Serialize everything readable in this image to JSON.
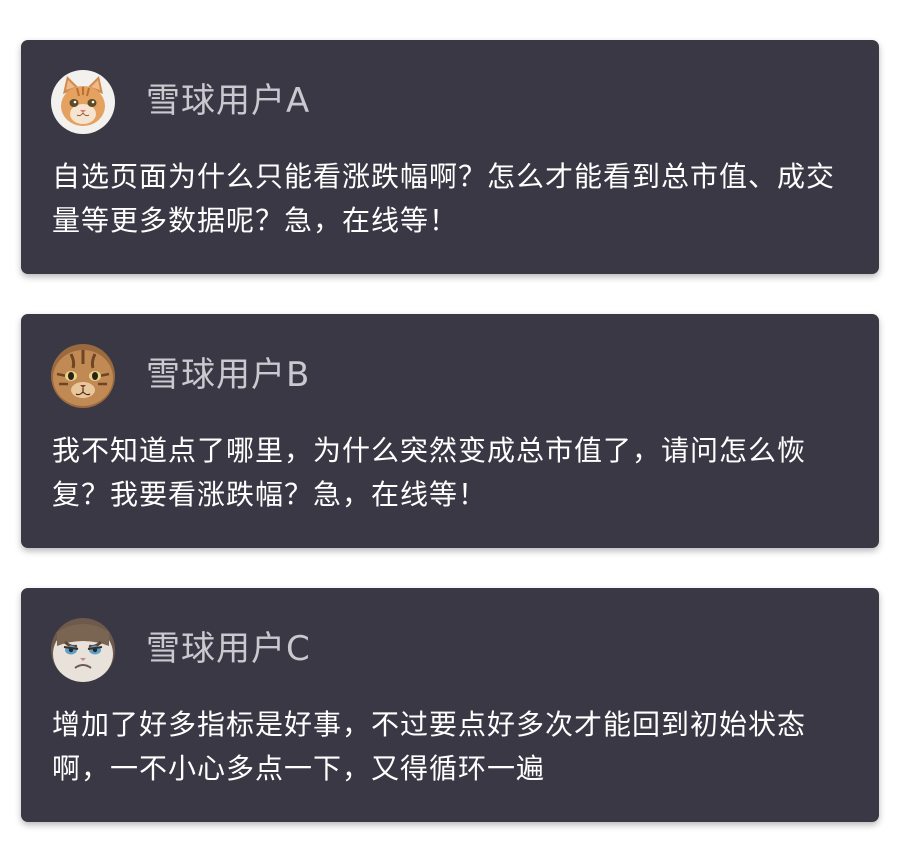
{
  "comments": [
    {
      "username": "雪球用户A",
      "avatar": "orange-kitten-avatar",
      "text": "自选页面为什么只能看涨跌幅啊？怎么才能看到总市值、成交量等更多数据呢？急，在线等！"
    },
    {
      "username": "雪球用户B",
      "avatar": "tabby-cat-avatar",
      "text": "我不知道点了哪里，为什么突然变成总市值了，请问怎么恢复？我要看涨跌幅？急，在线等！"
    },
    {
      "username": "雪球用户C",
      "avatar": "grumpy-cat-avatar",
      "text": "增加了好多指标是好事，不过要点好多次才能回到初始状态啊，一不小心多点一下，又得循环一遍"
    }
  ],
  "colors": {
    "card_background": "#393844",
    "username": "#c9c9cf",
    "comment_text": "#ffffff"
  }
}
